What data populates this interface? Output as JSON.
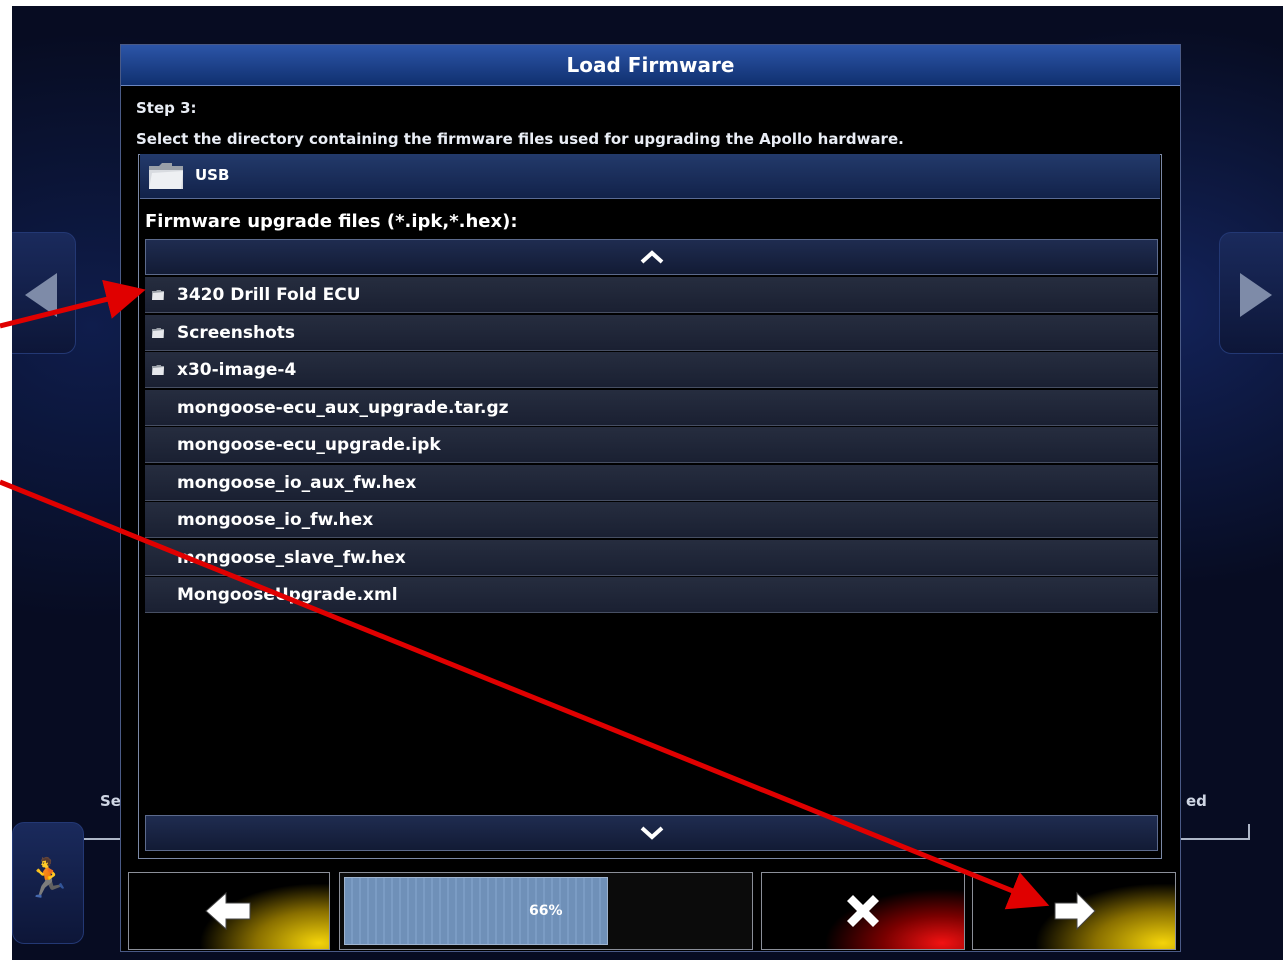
{
  "dialog": {
    "title": "Load Firmware",
    "step": "Step 3:",
    "instruction": "Select the directory containing the firmware files used for upgrading the Apollo hardware.",
    "current_directory": "USB",
    "files_label": "Firmware upgrade files (*.ipk,*.hex):"
  },
  "files": [
    {
      "name": "3420 Drill Fold ECU",
      "icon": "folder-icon"
    },
    {
      "name": "Screenshots",
      "icon": "folder-icon"
    },
    {
      "name": "x30-image-4",
      "icon": "folder-icon"
    },
    {
      "name": "mongoose-ecu_aux_upgrade.tar.gz",
      "icon": ""
    },
    {
      "name": "mongoose-ecu_upgrade.ipk",
      "icon": ""
    },
    {
      "name": "mongoose_io_aux_fw.hex",
      "icon": ""
    },
    {
      "name": "mongoose_io_fw.hex",
      "icon": ""
    },
    {
      "name": "mongoose_slave_fw.hex",
      "icon": ""
    },
    {
      "name": "MongooseUpgrade.xml",
      "icon": ""
    }
  ],
  "progress": {
    "text": "66%",
    "value": 0.66
  },
  "background": {
    "left_label": "Se",
    "right_label": "ed"
  },
  "colors": {
    "title_bar": "#1c44a0",
    "annotation_arrow": "#e00000",
    "nav_button": "#f4d40a",
    "cancel_button": "#f21212"
  }
}
